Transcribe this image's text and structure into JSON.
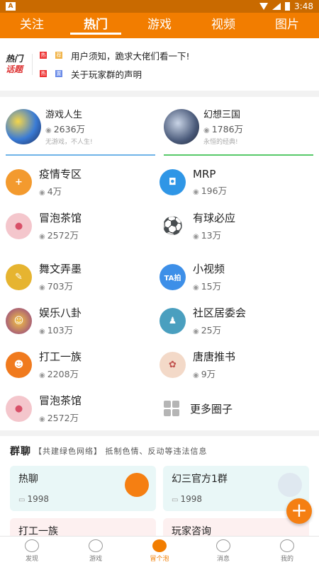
{
  "status": {
    "time": "3:48",
    "left_icon": "A"
  },
  "nav": {
    "tabs": [
      "关注",
      "热门",
      "游戏",
      "视频",
      "图片"
    ],
    "active": 1
  },
  "hot": {
    "logo_line1": "热门",
    "logo_line2": "话题",
    "items": [
      {
        "tag1": "热",
        "tag2": "荐",
        "text": "用户须知，跪求大佬们看一下!"
      },
      {
        "tag1": "热",
        "tag2": "置",
        "text": "关于玩家群的声明"
      }
    ]
  },
  "featured": [
    {
      "name": "游戏人生",
      "count": "2636万",
      "sub": "无游戏，不人生!",
      "line_color": "#6fb3e8",
      "icon": "game-avatar-icon"
    },
    {
      "name": "幻想三国",
      "count": "1786万",
      "sub": "永恒的经典!",
      "line_color": "#57c96a",
      "icon": "warrior-avatar-icon"
    }
  ],
  "circles": [
    {
      "name": "疫情专区",
      "count": "4万",
      "color": "#f39a2e",
      "glyph": "+",
      "icon": "medical-icon"
    },
    {
      "name": "MRP",
      "count": "196万",
      "color": "#2f96e6",
      "glyph": "◘",
      "icon": "gamepad-icon"
    },
    {
      "name": "冒泡茶馆",
      "count": "2572万",
      "color": "#e86a85",
      "glyph": "●",
      "icon": "teapot-icon"
    },
    {
      "name": "有球必应",
      "count": "13万",
      "color": "#3a3a3a",
      "glyph": "⚽",
      "icon": "soccer-icon"
    },
    {
      "name": "舞文弄墨",
      "count": "703万",
      "color": "#e6b430",
      "glyph": "✎",
      "icon": "quill-icon"
    },
    {
      "name": "小视频",
      "count": "15万",
      "color": "#3d8fe8",
      "glyph": "TA拍",
      "icon": "video-icon"
    },
    {
      "name": "娱乐八卦",
      "count": "103万",
      "color": "#8c3a8a",
      "glyph": "☺",
      "icon": "entertainment-icon"
    },
    {
      "name": "社区居委会",
      "count": "25万",
      "color": "#4a9fbf",
      "glyph": "♟",
      "icon": "community-icon"
    },
    {
      "name": "打工一族",
      "count": "2208万",
      "color": "#f07a1e",
      "glyph": "☻",
      "icon": "worker-icon"
    },
    {
      "name": "唐唐推书",
      "count": "9万",
      "color": "#e8b896",
      "glyph": "✿",
      "icon": "book-icon"
    },
    {
      "name": "冒泡茶馆",
      "count": "2572万",
      "color": "#e86a85",
      "glyph": "●",
      "icon": "teapot-icon"
    }
  ],
  "more": {
    "label": "更多圈子"
  },
  "group": {
    "title": "群聊",
    "notice": "【共建绿色网络】 抵制色情、反动等违法信息",
    "cards": [
      {
        "name": "热聊",
        "count": "1998",
        "icon_color": "#f57f12"
      },
      {
        "name": "幻三官方1群",
        "count": "1998",
        "icon_color": "#dfe8f0"
      }
    ],
    "cards2": [
      {
        "name": "打工一族"
      },
      {
        "name": "玩家咨询"
      }
    ]
  },
  "bottom": {
    "tabs": [
      {
        "label": "发现",
        "icon": "eye-icon"
      },
      {
        "label": "游戏",
        "icon": "gamepad-icon"
      },
      {
        "label": "冒个泡",
        "icon": "bubble-icon"
      },
      {
        "label": "消息",
        "icon": "message-icon"
      },
      {
        "label": "我的",
        "icon": "profile-icon"
      }
    ],
    "active": 2
  }
}
